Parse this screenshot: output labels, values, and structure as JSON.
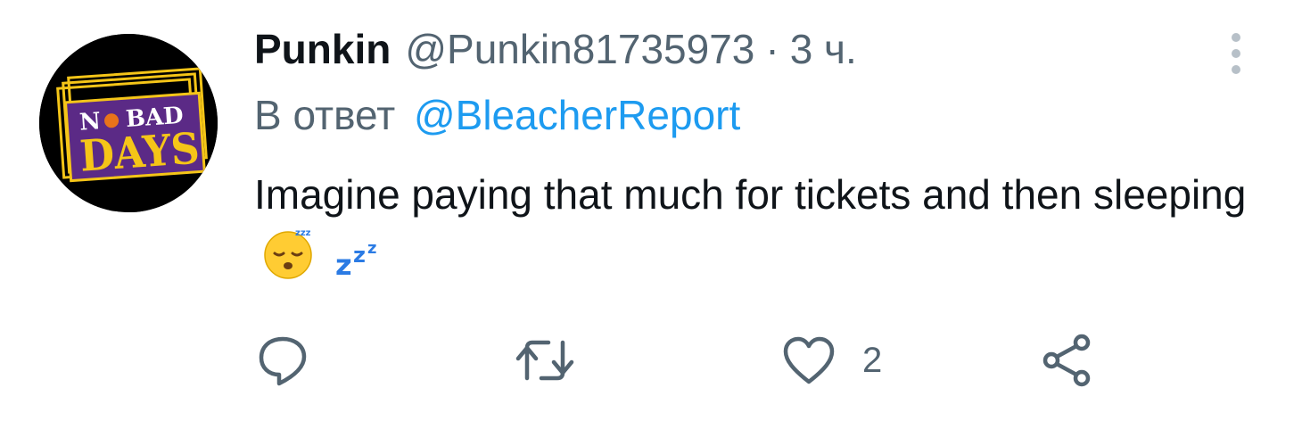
{
  "tweet": {
    "avatar": {
      "icon": "no-bad-days-logo",
      "logo_text": "NO BAD DAYS",
      "logo_line1_a": "N",
      "logo_line1_b": "BAD",
      "logo_line2": "DAYS"
    },
    "display_name": "Punkin",
    "handle": "@Punkin81735973",
    "separator": "·",
    "time": "3 ч.",
    "reply_prefix": "В ответ",
    "reply_mention": "@BleacherReport",
    "text": "Imagine paying that much for tickets and then sleeping",
    "emojis": [
      "sleeping-face-emoji",
      "zzz-emoji"
    ],
    "menu_icon": "more-vertical-icon",
    "actions": {
      "reply": {
        "icon": "reply-icon"
      },
      "retweet": {
        "icon": "retweet-icon"
      },
      "like": {
        "icon": "heart-icon",
        "count": "2"
      },
      "share": {
        "icon": "share-icon"
      }
    },
    "colors": {
      "text": "#0f1419",
      "secondary": "#536471",
      "link": "#1d9bf0",
      "logo_yellow": "#f5c518",
      "logo_purple": "#5b2a86"
    }
  }
}
